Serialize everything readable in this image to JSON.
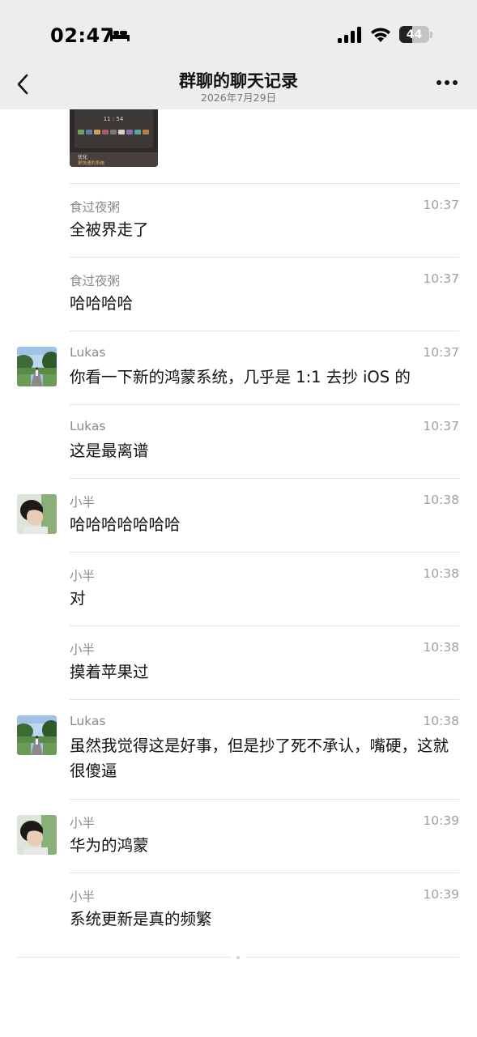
{
  "status_bar": {
    "time": "02:47",
    "battery_level": "44",
    "icons": [
      "bed-icon",
      "signal-icon",
      "wifi-icon",
      "battery-icon"
    ]
  },
  "nav": {
    "title": "群聊的聊天记录",
    "subtitle": "2026年7月29日",
    "back_icon": "chevron-left-icon",
    "more_icon": "more-dots-icon"
  },
  "messages": [
    {
      "sender": "食过夜粥",
      "time": "10:37",
      "text": "全被界走了"
    },
    {
      "sender": "食过夜粥",
      "time": "10:37",
      "text": "哈哈哈哈"
    },
    {
      "sender": "Lukas",
      "time": "10:37",
      "text": "你看一下新的鸿蒙系统，几乎是 1:1 去抄 iOS 的"
    },
    {
      "sender": "Lukas",
      "time": "10:37",
      "text": "这是最离谱"
    },
    {
      "sender": "小半",
      "time": "10:38",
      "text": "哈哈哈哈哈哈哈"
    },
    {
      "sender": "小半",
      "time": "10:38",
      "text": "对"
    },
    {
      "sender": "小半",
      "time": "10:38",
      "text": "摸着苹果过"
    },
    {
      "sender": "Lukas",
      "time": "10:38",
      "text": "虽然我觉得这是好事，但是抄了死不承认，嘴硬，这就很傻逼"
    },
    {
      "sender": "小半",
      "time": "10:39",
      "text": "华为的鸿蒙"
    },
    {
      "sender": "小半",
      "time": "10:39",
      "text": "系统更新是真的频繁"
    }
  ],
  "thumbnail": {
    "clock": "11 : 54",
    "caption_line1": "优化",
    "caption_line2": "更快速的系统"
  },
  "colors": {
    "header_bg": "#ededed",
    "divider": "#e4e4e4",
    "sender_text": "#8a8a8a",
    "time_text": "#a0a0a0"
  }
}
